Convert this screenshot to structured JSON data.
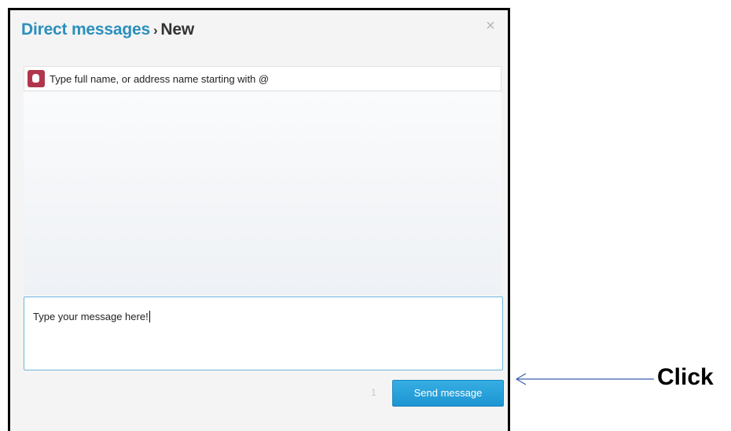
{
  "dialog": {
    "breadcrumb_link": "Direct messages",
    "breadcrumb_separator": "›",
    "breadcrumb_current": "New",
    "close_glyph": "×"
  },
  "recipient": {
    "placeholder": "Type full name, or address name starting with @"
  },
  "composer": {
    "text": "Type your message here!"
  },
  "footer": {
    "char_indicator": "1",
    "send_label": "Send message"
  },
  "annotation": {
    "label": "Click"
  },
  "colors": {
    "link": "#2a8fbd",
    "button": "#1c95d2",
    "avatar": "#b0364c"
  },
  "icons": {
    "close": "close-icon",
    "avatar": "avatar-icon"
  }
}
